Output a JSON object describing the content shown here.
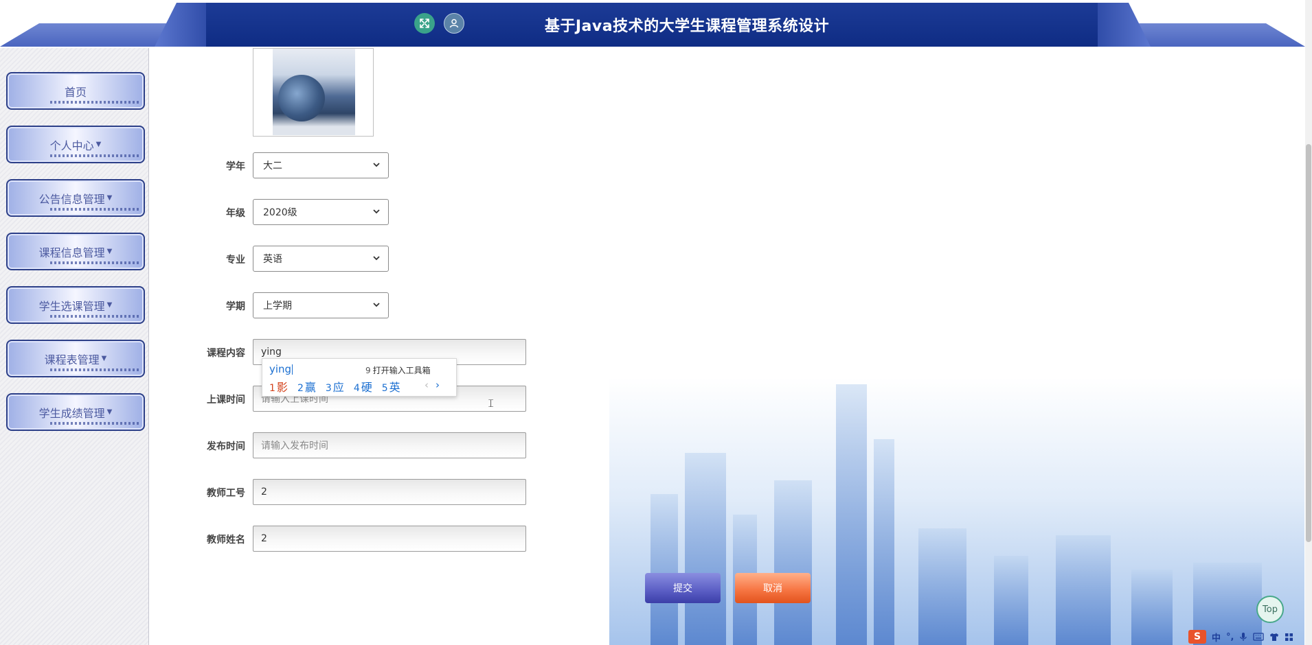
{
  "header": {
    "title": "基于Java技术的大学生课程管理系统设计",
    "icons": [
      "fullscreen-icon",
      "user-icon"
    ]
  },
  "sidebar": {
    "items": [
      {
        "label": "首页",
        "dropdown": false
      },
      {
        "label": "个人中心",
        "dropdown": true
      },
      {
        "label": "公告信息管理",
        "dropdown": true
      },
      {
        "label": "课程信息管理",
        "dropdown": true
      },
      {
        "label": "学生选课管理",
        "dropdown": true
      },
      {
        "label": "课程表管理",
        "dropdown": true
      },
      {
        "label": "学生成绩管理",
        "dropdown": true
      }
    ]
  },
  "form": {
    "fields": [
      {
        "label": "学年",
        "type": "select",
        "value": "大二"
      },
      {
        "label": "年级",
        "type": "select",
        "value": "2020级"
      },
      {
        "label": "专业",
        "type": "select",
        "value": "英语"
      },
      {
        "label": "学期",
        "type": "select",
        "value": "上学期"
      },
      {
        "label": "课程内容",
        "type": "input",
        "value": "ying",
        "placeholder": ""
      },
      {
        "label": "上课时间",
        "type": "input",
        "value": "",
        "placeholder": "请输入上课时间"
      },
      {
        "label": "发布时间",
        "type": "input",
        "value": "",
        "placeholder": "请输入发布时间"
      },
      {
        "label": "教师工号",
        "type": "input",
        "value": "2",
        "placeholder": ""
      },
      {
        "label": "教师姓名",
        "type": "input",
        "value": "2",
        "placeholder": ""
      }
    ],
    "submit_label": "提交",
    "cancel_label": "取消"
  },
  "ime": {
    "composition": "ying",
    "toolbox_index": "9",
    "toolbox_label": "打开输入工具箱",
    "candidates": [
      {
        "index": "1",
        "text": "影"
      },
      {
        "index": "2",
        "text": "赢"
      },
      {
        "index": "3",
        "text": "应"
      },
      {
        "index": "4",
        "text": "硬"
      },
      {
        "index": "5",
        "text": "英"
      }
    ],
    "prev": "‹",
    "next": "›"
  },
  "top_button": "Top",
  "tray": {
    "app": "S",
    "lang": "中",
    "punct": "°,"
  },
  "colors": {
    "header_bg": "#0f2c84",
    "submit": "#5a5dc4",
    "cancel": "#f77745",
    "ime_selected": "#d3421b",
    "ime_candidate": "#1b6fd1"
  }
}
